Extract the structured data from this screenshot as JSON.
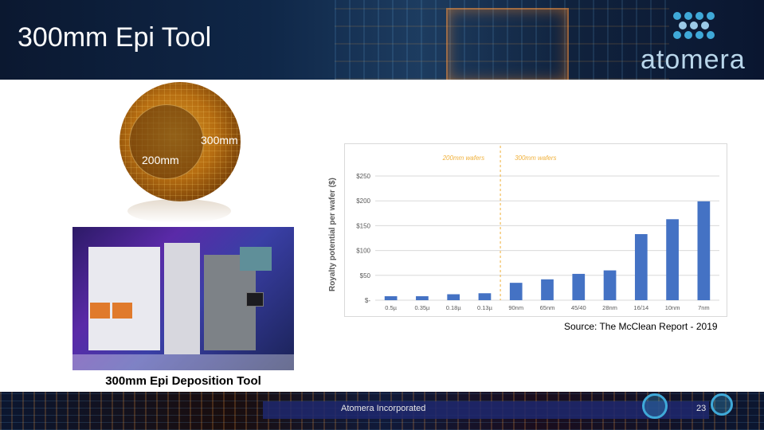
{
  "slide": {
    "title": "300mm Epi Tool",
    "logo_text": "atomera",
    "brand_colors": {
      "navy": "#0f2748",
      "logo_blue": "#3fa9d8",
      "bar_blue": "#4472c4",
      "divider_orange": "#f0b03a"
    }
  },
  "wafer_image": {
    "label_200": "200mm",
    "label_300": "300mm"
  },
  "tool_image": {
    "caption": "300mm Epi Deposition Tool"
  },
  "chart_data": {
    "type": "bar",
    "ylabel": "Royalty potential per wafer ($)",
    "categories": [
      "0.5µ",
      "0.35µ",
      "0.18µ",
      "0.13µ",
      "90nm",
      "65nm",
      "45/40",
      "28nm",
      "16/14",
      "10nm",
      "7nm"
    ],
    "values": [
      8,
      8,
      12,
      14,
      35,
      42,
      53,
      60,
      133,
      163,
      199
    ],
    "ylim": [
      0,
      250
    ],
    "ytick_labels": [
      "$-",
      "$50",
      "$100",
      "$150",
      "$200",
      "$250"
    ],
    "ytick_values": [
      0,
      50,
      100,
      150,
      200,
      250
    ],
    "grid": true,
    "annotations": [
      {
        "text": "200mm wafers",
        "region": "left"
      },
      {
        "text": "300mm wafers",
        "region": "right"
      }
    ],
    "divider_after_category": "0.13µ"
  },
  "source_note": "Source:  The McClean Report - 2019",
  "footer": {
    "company": "Atomera Incorporated",
    "page_number": "23"
  }
}
